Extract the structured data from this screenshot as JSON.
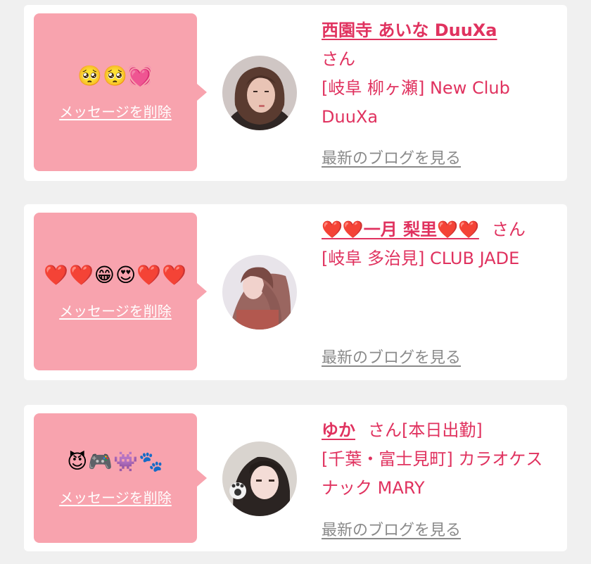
{
  "messages": [
    {
      "emoji": "🥺🥺💓",
      "delete_label": "メッセージを削除",
      "avatar_icon": "profile-photo",
      "name": "西園寺 あいな DuuXa",
      "suffix": "さん",
      "store": "[岐阜 柳ヶ瀬] New Club DuuXa",
      "blog_label": "最新のブログを見る"
    },
    {
      "emoji": "❤️❤️😁😍❤️❤️",
      "delete_label": "メッセージを削除",
      "avatar_icon": "profile-photo",
      "name": "❤️❤️一月 梨里❤️❤️",
      "suffix": "さん",
      "store": "[岐阜 多治見] CLUB JADE",
      "blog_label": "最新のブログを見る"
    },
    {
      "emoji": "😈🎮👾🐾",
      "delete_label": "メッセージを削除",
      "avatar_icon": "profile-photo",
      "name": "ゆか",
      "suffix": "さん[本日出勤]",
      "store": "[千葉・富士見町] カラオケスナック MARY",
      "blog_label": "最新のブログを見る"
    }
  ],
  "colors": {
    "accent": "#e0325f",
    "bubble": "#f8a3ae",
    "link_gray": "#8a8a8a",
    "background": "#f0f0f0",
    "card": "#ffffff"
  }
}
